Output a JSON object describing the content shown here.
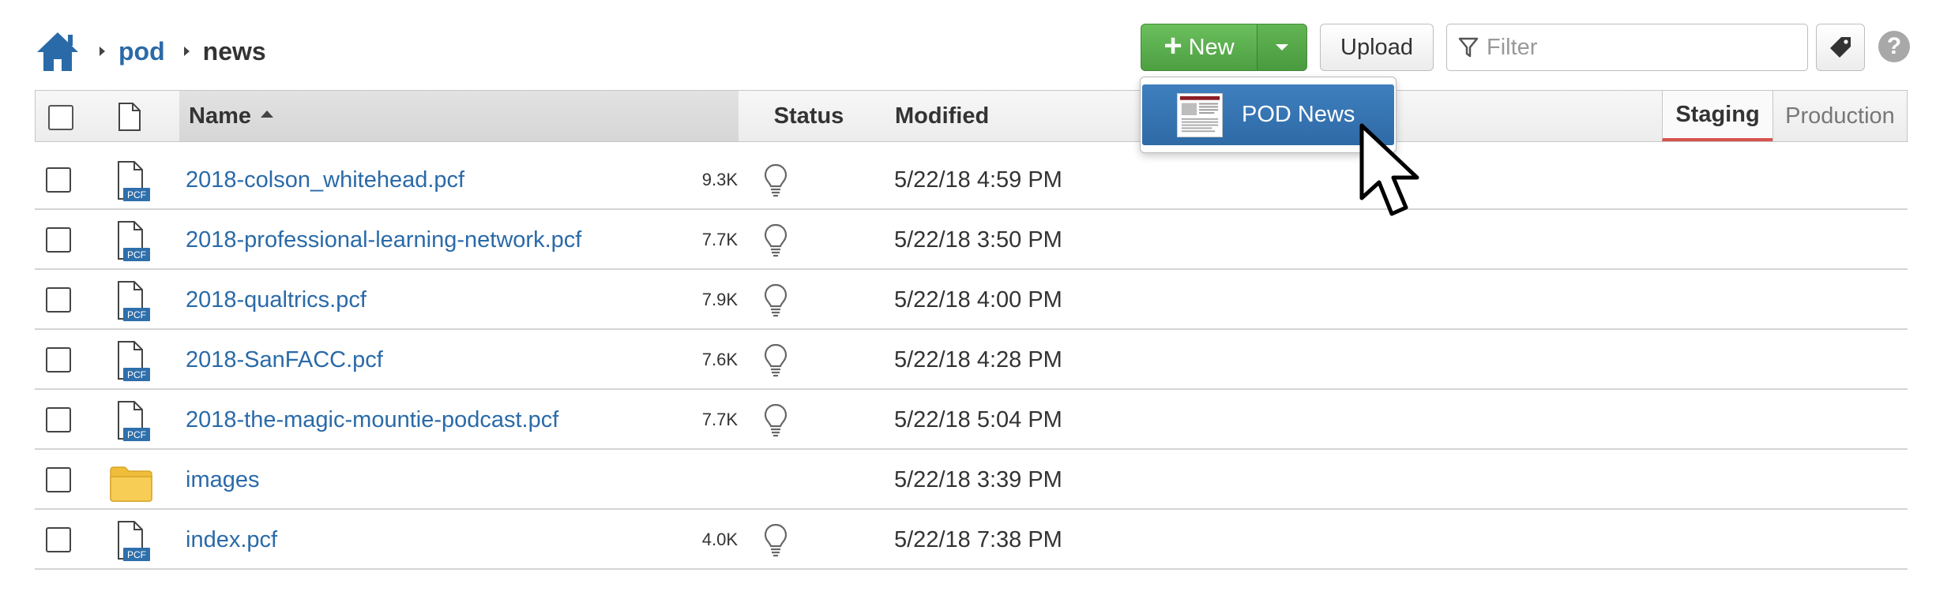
{
  "breadcrumb": {
    "items": [
      {
        "label": "pod",
        "link": true
      },
      {
        "label": "news",
        "link": false
      }
    ]
  },
  "toolbar": {
    "new_label": "New",
    "upload_label": "Upload",
    "filter_placeholder": "Filter"
  },
  "new_menu": {
    "items": [
      {
        "label": "POD News"
      }
    ]
  },
  "table": {
    "columns": {
      "name": "Name",
      "status": "Status",
      "modified": "Modified"
    },
    "env_tabs": [
      {
        "label": "Staging",
        "active": true
      },
      {
        "label": "Production",
        "active": false
      }
    ],
    "rows": [
      {
        "name": "2018-colson_whitehead.pcf",
        "type": "pcf",
        "size": "9.3K",
        "modified": "5/22/18 4:59 PM"
      },
      {
        "name": "2018-professional-learning-network.pcf",
        "type": "pcf",
        "size": "7.7K",
        "modified": "5/22/18 3:50 PM"
      },
      {
        "name": "2018-qualtrics.pcf",
        "type": "pcf",
        "size": "7.9K",
        "modified": "5/22/18 4:00 PM"
      },
      {
        "name": "2018-SanFACC.pcf",
        "type": "pcf",
        "size": "7.6K",
        "modified": "5/22/18 4:28 PM"
      },
      {
        "name": "2018-the-magic-mountie-podcast.pcf",
        "type": "pcf",
        "size": "7.7K",
        "modified": "5/22/18 5:04 PM"
      },
      {
        "name": "images",
        "type": "folder",
        "size": "",
        "modified": "5/22/18 3:39 PM"
      },
      {
        "name": "index.pcf",
        "type": "pcf",
        "size": "4.0K",
        "modified": "5/22/18 7:38 PM"
      }
    ]
  },
  "file_badge": "PCF",
  "colors": {
    "link": "#2a6aa8",
    "new_button": "#5cb050",
    "menu_highlight": "#3272b2",
    "active_tab_underline": "#d9534f"
  }
}
